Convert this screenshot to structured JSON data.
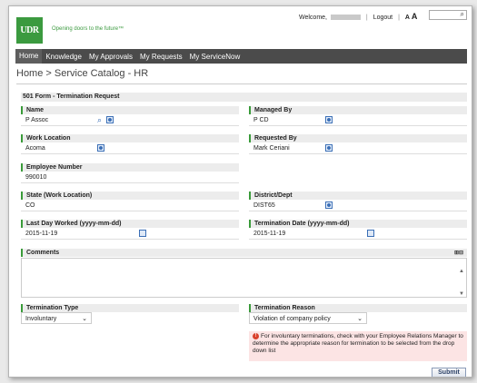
{
  "brand": {
    "logo_text": "UDR",
    "tagline": "Opening doors to the future™"
  },
  "userbar": {
    "welcome": "Welcome,",
    "logout": "Logout",
    "font_small": "A",
    "font_large": "A"
  },
  "nav": [
    "Home",
    "Knowledge",
    "My Approvals",
    "My Requests",
    "My ServiceNow"
  ],
  "breadcrumb": "Home > Service Catalog - HR",
  "form_title": "501 Form - Termination Request",
  "fields": {
    "name": {
      "label": "Name",
      "value": "P Assoc"
    },
    "managed_by": {
      "label": "Managed By",
      "value": "P CD"
    },
    "work_location": {
      "label": "Work Location",
      "value": "Acoma"
    },
    "requested_by": {
      "label": "Requested By",
      "value": "Mark Ceriani"
    },
    "employee_number": {
      "label": "Employee Number",
      "value": "990010"
    },
    "state": {
      "label": "State (Work Location)",
      "value": "CO"
    },
    "district": {
      "label": "District/Dept",
      "value": "DIST65"
    },
    "last_day": {
      "label": "Last Day Worked (yyyy-mm-dd)",
      "value": "2015-11-19"
    },
    "term_date": {
      "label": "Termination Date (yyyy-mm-dd)",
      "value": "2015-11-19"
    },
    "comments": {
      "label": "Comments",
      "value": ""
    },
    "term_type": {
      "label": "Termination Type",
      "value": "Involuntary"
    },
    "term_reason": {
      "label": "Termination Reason",
      "value": "Violation of company policy"
    }
  },
  "error_message": "For involuntary terminations, check with your Employee Relations Manager to determine the appropriate reason for termination to be selected from the drop down list",
  "submit_label": "Submit"
}
